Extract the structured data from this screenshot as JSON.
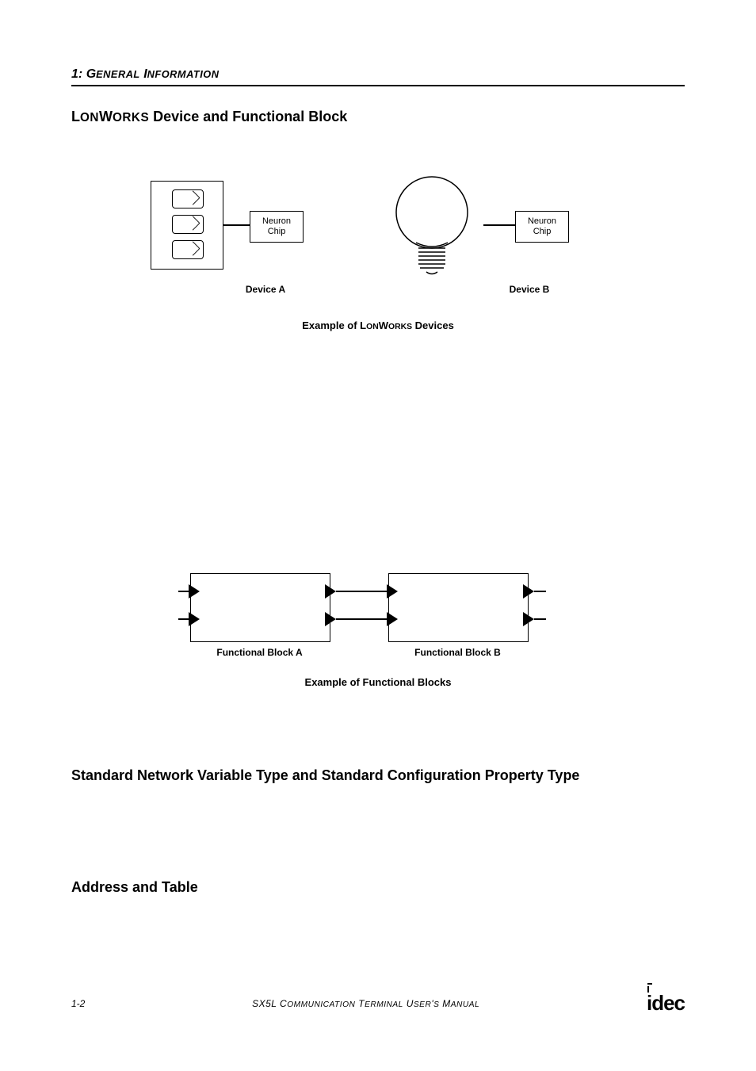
{
  "header": {
    "chapter_num": "1:",
    "chapter_title_1": "G",
    "chapter_title_rest1": "ENERAL",
    "chapter_title_2": "I",
    "chapter_title_rest2": "NFORMATION"
  },
  "sections": {
    "s1_prefix": "L",
    "s1_on": "ON",
    "s1_w": "W",
    "s1_orks": "ORKS",
    "s1_rest": " Device and Functional Block",
    "s2": "Standard Network Variable Type and Standard Configuration Property Type",
    "s3": "Address and Table"
  },
  "figure1": {
    "neuron_label": "Neuron Chip",
    "device_a_label": "Device A",
    "device_b_label": "Device B",
    "caption_prefix": "Example of L",
    "caption_on": "ON",
    "caption_w": "W",
    "caption_orks": "ORKS",
    "caption_suffix": " Devices"
  },
  "figure2": {
    "fblock_a_label": "Functional Block A",
    "fblock_b_label": "Functional Block B",
    "caption": "Example of Functional Blocks"
  },
  "footer": {
    "page_num": "1-2",
    "title": "SX5L Communication Terminal User's Manual",
    "logo": "idec"
  }
}
